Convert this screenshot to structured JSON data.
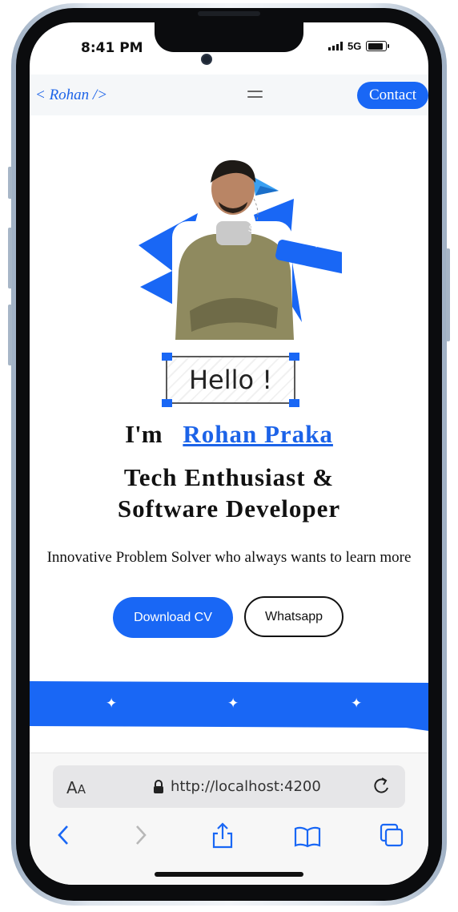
{
  "status_bar": {
    "time": "8:41 PM",
    "network": "5G"
  },
  "nav": {
    "brand": "< Rohan />",
    "contact_label": "Contact"
  },
  "hero": {
    "badge": "Software Developer",
    "hello": "Hello !",
    "intro_prefix": "I'm",
    "name": "Rohan Praka",
    "role_line1": "Tech Enthusiast &",
    "role_line2": "Software Developer",
    "tagline": "Innovative Problem Solver who always wants to learn more"
  },
  "buttons": {
    "download_cv": "Download CV",
    "whatsapp": "Whatsapp"
  },
  "safari": {
    "aa_big": "A",
    "aa_small": "A",
    "url": "http://localhost:4200"
  },
  "colors": {
    "accent": "#1967f5",
    "brand_text": "#1c63e8"
  }
}
